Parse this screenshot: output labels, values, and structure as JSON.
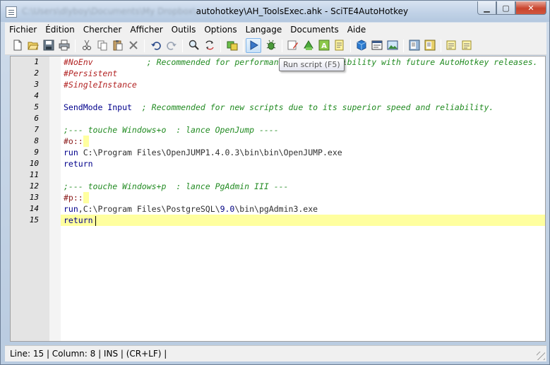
{
  "window": {
    "title_prefix": "C:\\Users\\dlyboy\\Documents\\My Dropbox\\",
    "title_main": "autohotkey\\AH_ToolsExec.ahk - SciTE4AutoHotkey",
    "minimize": "▁",
    "maximize": "▢",
    "close": "✕"
  },
  "menu": [
    "Fichier",
    "Édition",
    "Chercher",
    "Afficher",
    "Outils",
    "Options",
    "Langage",
    "Documents",
    "Aide"
  ],
  "toolbar": {
    "icons": [
      "new-file-icon",
      "open-folder-icon",
      "save-icon",
      "print-icon",
      "cut-icon",
      "copy-icon",
      "paste-icon",
      "delete-icon",
      "undo-icon",
      "redo-icon",
      "find-icon",
      "replace-icon",
      "compile-icon",
      "run-script-icon",
      "debug-icon",
      "tool-pencil-icon",
      "tool-green-icon",
      "tool-a-icon",
      "tool-yellow-icon",
      "cube-icon",
      "window-icon",
      "image-icon",
      "ide-icon",
      "ide-alt-icon",
      "notes-icon",
      "notes-alt-icon"
    ]
  },
  "tooltip": {
    "text": "Run script (F5)"
  },
  "editor": {
    "line_numbers": [
      "1",
      "2",
      "3",
      "4",
      "5",
      "6",
      "7",
      "8",
      "9",
      "10",
      "11",
      "12",
      "13",
      "14",
      "15"
    ],
    "current_line": 15,
    "lines": {
      "l1_dir": "#NoEnv",
      "l1_cmt": "; Recommended for performance and compatibility with future AutoHotkey releases.",
      "l2_dir": "#Persistent",
      "l3_dir": "#SingleInstance",
      "l5_cmd": "SendMode Input",
      "l5_cmt": "; Recommended for new scripts due to its superior speed and reliability.",
      "l7_cmt": ";--- touche Windows+o  : lance OpenJump ----",
      "l8_lbl": "#o::",
      "l9_cmd": "run",
      "l9_txt": "C:\\Program Files\\OpenJUMP1.4.0.3\\bin\\bin\\OpenJUMP.exe",
      "l10_cmd": "return",
      "l12_cmt": ";--- touche Windows+p  : lance PgAdmin III ---",
      "l13_lbl": "#p::",
      "l14_cmd": "run",
      "l14_txt_a": ",C:\\Program Files\\PostgreSQL\\",
      "l14_num": "9.0",
      "l14_txt_b": "\\bin\\pgAdmin3.exe",
      "l15_cmd": "return"
    }
  },
  "status": {
    "text": "Line: 15 | Column: 8 | INS | (CR+LF) |"
  }
}
